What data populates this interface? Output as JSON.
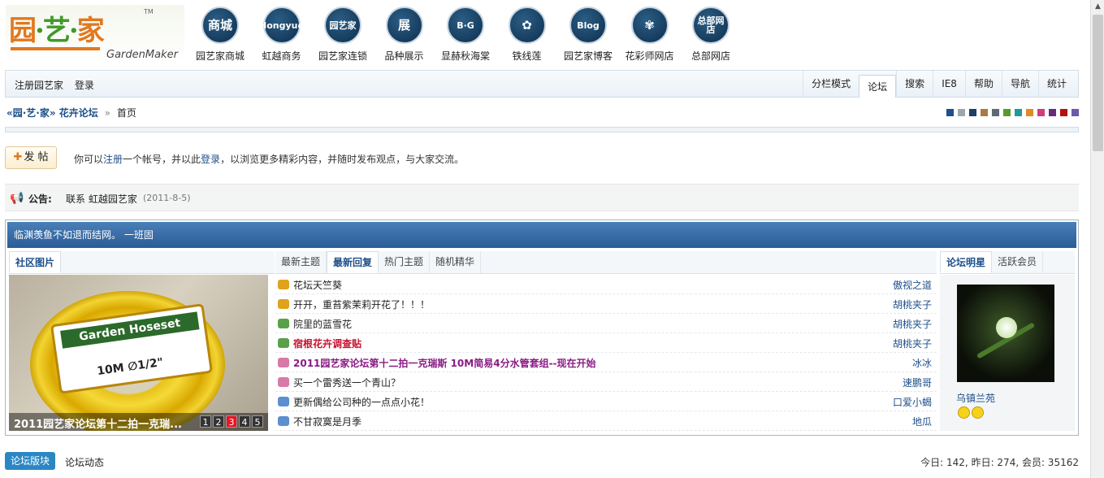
{
  "logo": {
    "main_a": "园",
    "main_b": "艺",
    "main_c": "家",
    "tm": "TM",
    "sub": "GardenMaker"
  },
  "nav_icons": [
    {
      "glyph": "商城",
      "label": "园艺家商城",
      "name": "mall-icon"
    },
    {
      "glyph": "Hongyue",
      "label": "虹越商务",
      "name": "hongyue-icon"
    },
    {
      "glyph": "园艺家",
      "label": "园艺家连锁",
      "name": "chain-icon"
    },
    {
      "glyph": "展",
      "label": "品种展示",
      "name": "exhibit-icon"
    },
    {
      "glyph": "B·G",
      "label": "显赫秋海棠",
      "name": "begonia-icon"
    },
    {
      "glyph": "✿",
      "label": "铁线莲",
      "name": "clematis-icon"
    },
    {
      "glyph": "Blog",
      "label": "园艺家博客",
      "name": "blog-icon"
    },
    {
      "glyph": "✾",
      "label": "花彩师网店",
      "name": "florist-shop-icon"
    },
    {
      "glyph": "总部网店",
      "label": "总部网店",
      "name": "hq-shop-icon"
    }
  ],
  "menubar": {
    "register": "注册园艺家",
    "login": "登录",
    "right": [
      "分栏模式",
      "论坛",
      "搜索",
      "IE8",
      "帮助",
      "导航",
      "统计"
    ],
    "active_index": 1
  },
  "crumb": {
    "site": "«园·艺·家» 花卉论坛",
    "sep": "»",
    "page": "首页"
  },
  "swatches": [
    "#1f4e8c",
    "#9aa8b3",
    "#1d3d6b",
    "#a77b43",
    "#5e6a74",
    "#5a9a2a",
    "#1e9c98",
    "#e08a2a",
    "#d23c7d",
    "#6a2a7a",
    "#b41212",
    "#6a5aa8"
  ],
  "post": {
    "plus": "✚",
    "label": "发 帖"
  },
  "notice": {
    "a": "你可以",
    "register": "注册",
    "b": "一个帐号，并以此",
    "login": "登录",
    "c": "，以浏览更多精彩内容，并随时发布观点，与大家交流。"
  },
  "announce": {
    "label": "公告:",
    "text": "联系 虹越园艺家",
    "date": "(2011-8-5)"
  },
  "blue_header": "临渊羡鱼不如退而结网。 一班固",
  "pic_tab": "社区图片",
  "list_tabs": [
    "最新主题",
    "最新回复",
    "热门主题",
    "随机精华"
  ],
  "list_active": 1,
  "star_tabs": [
    "论坛明星",
    "活跃会员"
  ],
  "pic": {
    "caption": "2011园艺家论坛第十二拍一克瑞...",
    "label_top": "Garden Hoseset",
    "label_bottom": "10M ∅1/2\"",
    "pages": [
      "1",
      "2",
      "3",
      "4",
      "5"
    ],
    "current_page": 3
  },
  "replies": [
    {
      "title": "花坛天竺葵",
      "author": "傲视之道",
      "icon_color": "#e0a21c",
      "style": "normal"
    },
    {
      "title": "开开，重苔紫茉莉开花了！！！",
      "author": "胡桃夹子",
      "icon_color": "#e0a21c",
      "style": "normal"
    },
    {
      "title": "院里的蓝雪花",
      "author": "胡桃夹子",
      "icon_color": "#5aa04a",
      "style": "normal"
    },
    {
      "title": "宿根花卉调查贴",
      "author": "胡桃夹子",
      "icon_color": "#5aa04a",
      "style": "red"
    },
    {
      "title": "2011园艺家论坛第十二拍一克瑞斯 10M简易4分水管套组--现在开始",
      "author": "冰冰",
      "icon_color": "#d87aa8",
      "style": "purple"
    },
    {
      "title": "买一个雷秀送一个青山？",
      "author": "速鹏哥",
      "icon_color": "#d87aa8",
      "style": "normal"
    },
    {
      "title": "更新偶给公司种的一点点小花！",
      "author": "口爱小蝎",
      "icon_color": "#5b8fd0",
      "style": "normal"
    },
    {
      "title": "不甘寂寞是月季",
      "author": "地瓜",
      "icon_color": "#5b8fd0",
      "style": "normal"
    }
  ],
  "star": {
    "name": "乌镇兰苑"
  },
  "footer": {
    "button": "论坛版块",
    "dynamic": "论坛动态",
    "stats": "今日: 142, 昨日: 274, 会员: 35162"
  }
}
